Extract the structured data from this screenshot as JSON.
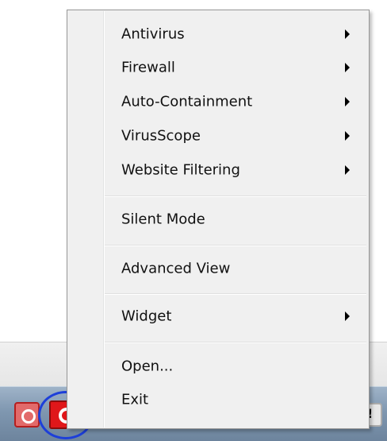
{
  "menu": {
    "items": [
      {
        "label": "Antivirus",
        "has_submenu": true
      },
      {
        "label": "Firewall",
        "has_submenu": true
      },
      {
        "label": "Auto-Containment",
        "has_submenu": true
      },
      {
        "label": "VirusScope",
        "has_submenu": true
      },
      {
        "label": "Website Filtering",
        "has_submenu": true
      },
      {
        "label": "Silent Mode",
        "has_submenu": false
      },
      {
        "label": "Advanced View",
        "has_submenu": false
      },
      {
        "label": "Widget",
        "has_submenu": true
      },
      {
        "label": "Open...",
        "has_submenu": false
      },
      {
        "label": "Exit",
        "has_submenu": false
      }
    ]
  },
  "taskbar": {
    "tray_icons": [
      {
        "name": "red-cog-icon"
      },
      {
        "name": "comodo-icon",
        "highlighted": true,
        "highlight_color": "#1d3fd9"
      },
      {
        "name": "orange-icon"
      },
      {
        "name": "wrench-icon"
      },
      {
        "name": "blue-orb-icon"
      },
      {
        "name": "green-check-icon"
      },
      {
        "name": "speaker-icon"
      },
      {
        "name": "monitor-icon"
      },
      {
        "name": "folder-icon"
      },
      {
        "name": "action-center-flag-icon"
      }
    ]
  }
}
